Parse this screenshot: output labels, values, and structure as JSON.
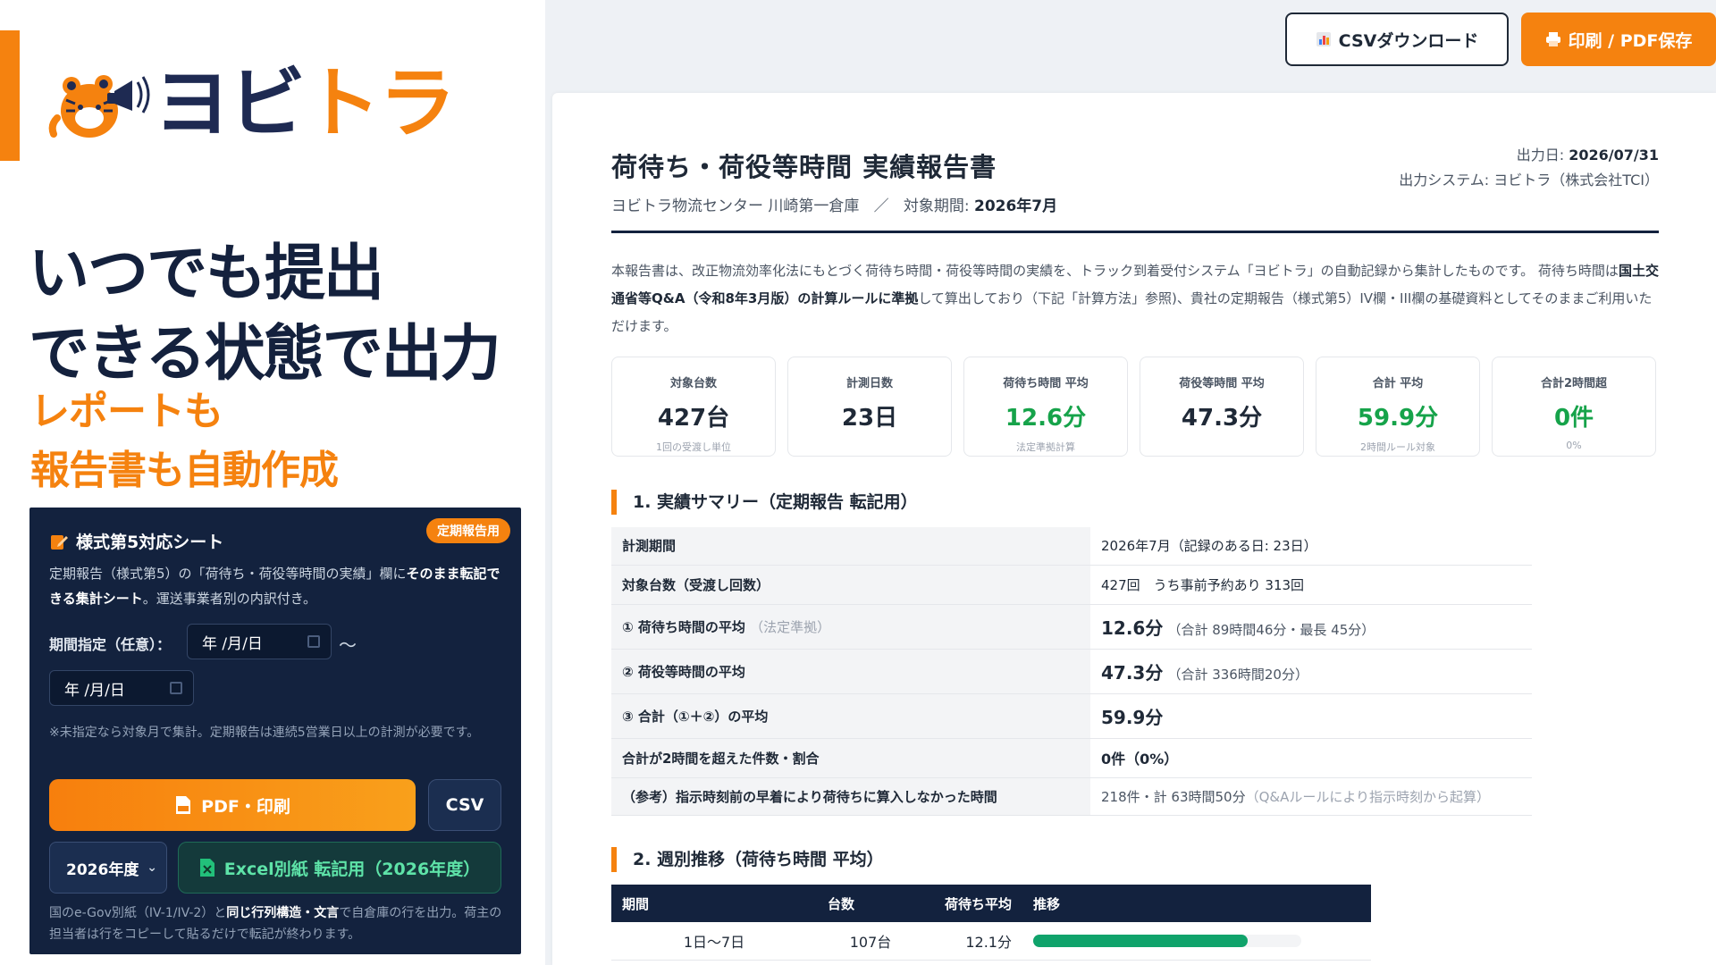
{
  "brand": {
    "part1": "ヨビ",
    "part2": "トラ"
  },
  "hero": {
    "line1": "いつでも提出",
    "line2": "できる状態で出力",
    "sub1": "レポートも",
    "sub2": "報告書も自動作成"
  },
  "card": {
    "title": "様式第5対応シート",
    "badge": "定期報告用",
    "desc_a": "定期報告（様式第5）の「荷待ち・荷役等時間の実績」欄に",
    "desc_b": "そのまま転記できる集計シート",
    "desc_c": "。運送事業者別の内訳付き。",
    "period_label": "期間指定（任意）：",
    "date_from": "年 /月/日",
    "date_to": "年 /月/日",
    "tilde": "〜",
    "note": "※未指定なら対象月で集計。定期報告は連続5営業日以上の計測が必要です。",
    "pdf_button": "PDF・印刷",
    "csv_button": "CSV",
    "year_select": "2026年度",
    "excel_button": "Excel別紙 転記用（2026年度）",
    "foot_a": "国のe-Gov別紙（IV-1/IV-2）と",
    "foot_b": "同じ行列構造・文言",
    "foot_c": "で自倉庫の行を出力。荷主の担当者は行をコピーして貼るだけで転記が終わります。"
  },
  "toolbar": {
    "csv_download": "CSVダウンロード",
    "print_pdf": "印刷 / PDF保存"
  },
  "report": {
    "title": "荷待ち・荷役等時間 実績報告書",
    "facility": "ヨビトラ物流センター 川崎第一倉庫",
    "separator": "／",
    "period_label": "対象期間:",
    "period_value": "2026年7月",
    "output_date_label": "出力日:",
    "output_date_value": "2026/07/31",
    "output_system": "出力システム: ヨビトラ（株式会社TCI）",
    "intro_a": "本報告書は、改正物流効率化法にもとづく荷待ち時間・荷役等時間の実績を、トラック到着受付システム「ヨビトラ」の自動記録から集計したものです。 荷待ち時間は",
    "intro_b": "国土交通省等Q&A（令和8年3月版）の計算ルールに準拠",
    "intro_c": "して算出しており（下記「計算方法」参照)、貴社の定期報告（様式第5）IV欄・III欄の基礎資料としてそのままご利用いただけます。"
  },
  "kpis": [
    {
      "label": "対象台数",
      "value": "427台",
      "note": "1回の受渡し単位",
      "green": false
    },
    {
      "label": "計測日数",
      "value": "23日",
      "note": "",
      "green": false
    },
    {
      "label": "荷待ち時間 平均",
      "value": "12.6分",
      "note": "法定準拠計算",
      "green": true
    },
    {
      "label": "荷役等時間 平均",
      "value": "47.3分",
      "note": "",
      "green": false
    },
    {
      "label": "合計 平均",
      "value": "59.9分",
      "note": "2時間ルール対象",
      "green": true
    },
    {
      "label": "合計2時間超",
      "value": "0件",
      "note": "0%",
      "green": true
    }
  ],
  "section1": {
    "heading": "1. 実績サマリー（定期報告 転記用）",
    "rows": [
      {
        "key": "計測期間",
        "key_note": "",
        "value": "2026年7月（記録のある日: 23日）",
        "value_note": ""
      },
      {
        "key": "対象台数（受渡し回数）",
        "key_note": "",
        "value": "427回　うち事前予約あり 313回",
        "value_note": ""
      },
      {
        "key": "① 荷待ち時間の平均",
        "key_note": "（法定準拠）",
        "value": "12.6分",
        "value_note": "（合計 89時間46分・最長 45分）"
      },
      {
        "key": "② 荷役等時間の平均",
        "key_note": "",
        "value": "47.3分",
        "value_note": "（合計 336時間20分）"
      },
      {
        "key": "③ 合計（①＋②）の平均",
        "key_note": "",
        "value": "59.9分",
        "value_note": ""
      },
      {
        "key": "合計が2時間を超えた件数・割合",
        "key_note": "",
        "value": "0件（0%）",
        "value_note": ""
      },
      {
        "key": "（参考）指示時刻前の早着により荷待ちに算入しなかった時間",
        "key_note": "",
        "value": "218件・計 63時間50分",
        "value_note": "（Q&Aルールにより指示時刻から起算）"
      }
    ]
  },
  "section2": {
    "heading": "2. 週別推移（荷待ち時間 平均）",
    "columns": [
      "期間",
      "台数",
      "荷待ち平均",
      "推移"
    ],
    "rows": [
      {
        "period": "1日〜7日",
        "count": "107台",
        "avg": "12.1分",
        "level": 0.8
      }
    ]
  }
}
